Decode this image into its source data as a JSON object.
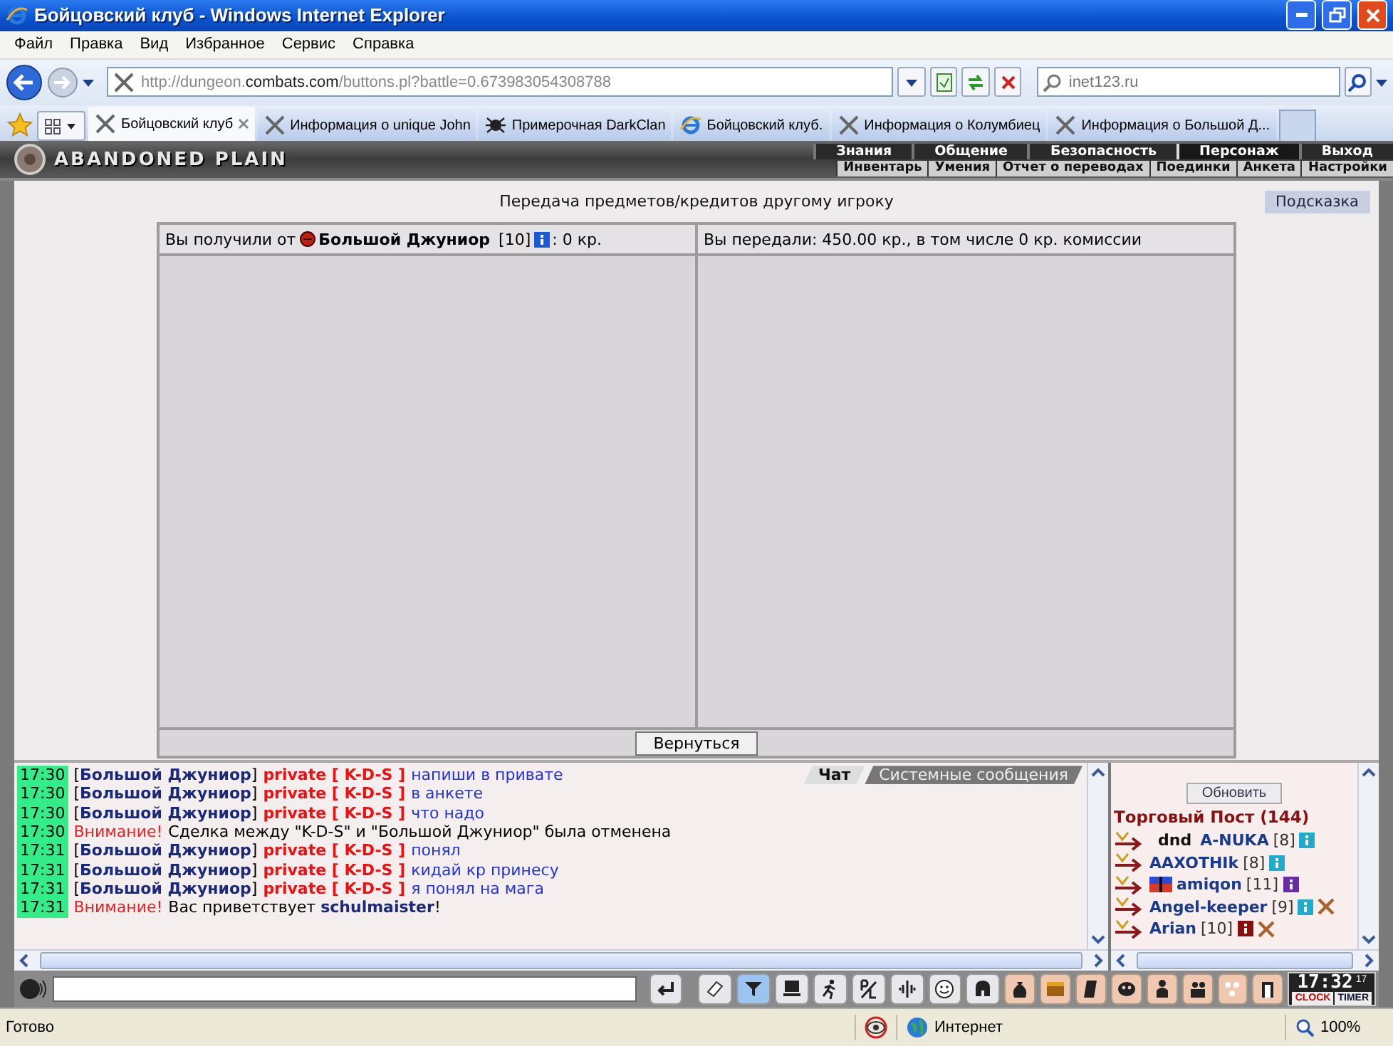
{
  "window": {
    "title": "Бойцовский клуб - Windows Internet Explorer"
  },
  "menu": [
    "Файл",
    "Правка",
    "Вид",
    "Избранное",
    "Сервис",
    "Справка"
  ],
  "address_bar": {
    "url": "http://dungeon.**combats.com**/buttons.pl?battle=0.673983054308788"
  },
  "search": {
    "value": "inet123.ru"
  },
  "tabs": [
    {
      "label": "Бойцовский клуб",
      "kind": "swords",
      "selected": true
    },
    {
      "label": "Информация о unique John",
      "kind": "swords",
      "selected": false
    },
    {
      "label": "Примерочная DarkClan",
      "kind": "spider",
      "selected": false
    },
    {
      "label": "Бойцовский клуб.",
      "kind": "ie",
      "selected": false
    },
    {
      "label": "Информация о Колумбиец",
      "kind": "swords",
      "selected": false
    },
    {
      "label": "Информация о Большой Д...",
      "kind": "swords",
      "selected": false
    }
  ],
  "game_nav": {
    "logo": "ABANDONED PLAIN",
    "top": [
      {
        "label": "Знания",
        "selected": false
      },
      {
        "label": "Общение",
        "selected": false
      },
      {
        "label": "Безопасность",
        "selected": false
      },
      {
        "label": "Персонаж",
        "selected": true
      },
      {
        "label": "Выход",
        "selected": false
      }
    ],
    "sub": [
      "Инвентарь",
      "Умения",
      "Отчет о переводах",
      "Поединки",
      "Анкета",
      "Настройки"
    ]
  },
  "transfer": {
    "title": "Передача предметов/кредитов другому игроку",
    "hint_button": "Подсказка",
    "received": {
      "prefix": "Вы получили от",
      "name": "Большой Джуниор",
      "level": "[10]",
      "suffix": ": 0 кр."
    },
    "sent": "Вы передали: 450.00 кр., в том числе 0 кр. комиссии",
    "back_button": "Вернуться"
  },
  "chat": {
    "tabs": [
      {
        "label": "Чат",
        "selected": true
      },
      {
        "label": "Системные сообщения",
        "selected": false
      }
    ],
    "messages": [
      {
        "kind": "private",
        "time": "17:30",
        "author": "[**Большой Джуниор**]",
        "channel": "private [ K-D-S ]",
        "text": "напиши в привате"
      },
      {
        "kind": "private",
        "time": "17:30",
        "author": "[**Большой Джуниор**]",
        "channel": "private [ K-D-S ]",
        "text": "в анкете"
      },
      {
        "kind": "private",
        "time": "17:30",
        "author": "[**Большой Джуниор**]",
        "channel": "private [ K-D-S ]",
        "text": "что надо"
      },
      {
        "kind": "notice",
        "time": "17:30",
        "label": "Внимание!",
        "text": "Сделка между \"K-D-S\" и \"Большой Джуниор\" была отменена"
      },
      {
        "kind": "private",
        "time": "17:31",
        "author": "[**Большой Джуниор**]",
        "channel": "private [ K-D-S ]",
        "text": "понял"
      },
      {
        "kind": "private",
        "time": "17:31",
        "author": "[**Большой Джуниор**]",
        "channel": "private [ K-D-S ]",
        "text": "кидай кр принесу"
      },
      {
        "kind": "private",
        "time": "17:31",
        "author": "[**Большой Джуниор**]",
        "channel": "private [ K-D-S ]",
        "text": "я понял на мага"
      },
      {
        "kind": "notice",
        "time": "17:31",
        "label": "Внимание!",
        "text": "Вас приветствует **schulmaister**!"
      }
    ]
  },
  "trade_post": {
    "refresh_button": "Обновить",
    "title": "Торговый Пост (144)",
    "users": [
      {
        "prefix": "dnd",
        "flag": false,
        "name": "A-NUKA",
        "level": "[8]",
        "color": "#22aacc",
        "swords": false
      },
      {
        "flag": false,
        "name": "AAXOTHIk",
        "level": "[8]",
        "color": "#22aacc",
        "swords": false
      },
      {
        "flag": true,
        "name": "amiqon",
        "level": "[11]",
        "color": "#6a2aa8",
        "swords": false
      },
      {
        "flag": false,
        "name": "Angel-keeper",
        "level": "[9]",
        "color": "#22aacc",
        "swords": true
      },
      {
        "flag": false,
        "name": "Arian",
        "level": "[10]",
        "color": "#8a1010",
        "swords": true
      }
    ]
  },
  "toolbar": {
    "buttons": [
      {
        "kind": "enter",
        "selected": false
      },
      {
        "kind": "eraser",
        "selected": false
      },
      {
        "kind": "filter",
        "selected": true
      },
      {
        "kind": "monitor",
        "selected": false
      },
      {
        "kind": "runner",
        "selected": false
      },
      {
        "kind": "pl",
        "selected": false
      },
      {
        "kind": "sound",
        "selected": false
      },
      {
        "kind": "smiley",
        "selected": false
      },
      {
        "kind": "helmet",
        "selected": false
      }
    ],
    "game_buttons": [
      {
        "kind": "bag"
      },
      {
        "kind": "chest"
      },
      {
        "kind": "scroll"
      },
      {
        "kind": "mask"
      },
      {
        "kind": "figure"
      },
      {
        "kind": "people"
      },
      {
        "kind": "dots"
      },
      {
        "kind": "exit"
      }
    ],
    "clock": {
      "time": "17:32",
      "seconds": "17",
      "clock_label": "CLOCK",
      "timer_label": "TIMER"
    }
  },
  "status_bar": {
    "text": "Готово",
    "zone": "Интернет",
    "zoom": "100%"
  }
}
